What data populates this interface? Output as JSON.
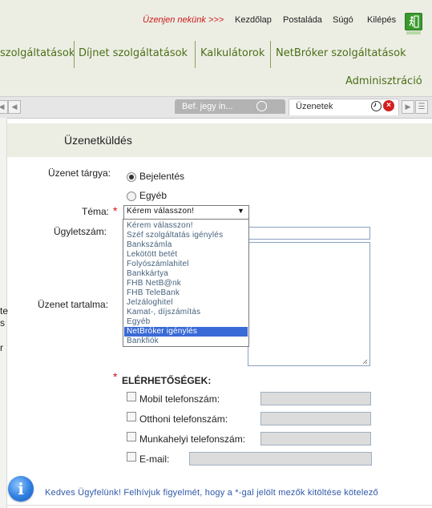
{
  "top_links": {
    "contact": "Üzenjen nekünk >>>",
    "home": "Kezdőlap",
    "mailbox": "Postaláda",
    "help": "Súgó",
    "logout": "Kilépés"
  },
  "nav": {
    "items": [
      "szolgáltatások",
      "Díjnet szolgáltatások",
      "Kalkulátorok",
      "NetBróker szolgáltatások"
    ],
    "admin": "Adminisztráció"
  },
  "tabs": {
    "inactive_label": "Bef. jegy in...",
    "active_label": "Üzenetek"
  },
  "left_fragments": [
    "te",
    "s",
    "r"
  ],
  "panel": {
    "title": "Üzenetküldés"
  },
  "form": {
    "subject_label": "Üzenet tárgya:",
    "radio_options": [
      "Bejelentés",
      "Egyéb"
    ],
    "radio_selected": "Bejelentés",
    "topic_label": "Téma:",
    "required_mark": "*",
    "topic_value": "Kérem válasszon!",
    "topic_options": [
      "Kérem válasszon!",
      "Széf szolgáltatás igénylés",
      "Bankszámla",
      "Lekötött betét",
      "Folyószámlahitel",
      "Bankkártya",
      "FHB NetB@nk",
      "FHB TeleBank",
      "Jelzáloghitel",
      "Kamat-, díjszámítás",
      "Egyéb",
      "NetBróker igénylés",
      "Bankfiók"
    ],
    "topic_highlighted": "NetBróker igénylés",
    "ref_label": "Ügyletszám:",
    "message_label": "Üzenet tartalma:",
    "contacts_title": "ELÉRHETŐSÉGEK:",
    "contacts": [
      {
        "label": "Mobil telefonszám:",
        "value": ""
      },
      {
        "label": "Otthoni telefonszám:",
        "value": ""
      },
      {
        "label": "Munkahelyi telefonszám:",
        "value": ""
      },
      {
        "label": "E-mail:",
        "value": ""
      }
    ]
  },
  "info": {
    "icon": "i",
    "text": "Kedves Ügyfelünk! Felhívjuk figyelmét, hogy a *-gal jelölt mezők kitöltése kötelező"
  },
  "colors": {
    "nav_green": "#4c6f17",
    "header_bg": "#eceee4",
    "required_red": "#d01010",
    "highlight_blue": "#3a6ad6",
    "info_blue": "#2f58a8"
  }
}
